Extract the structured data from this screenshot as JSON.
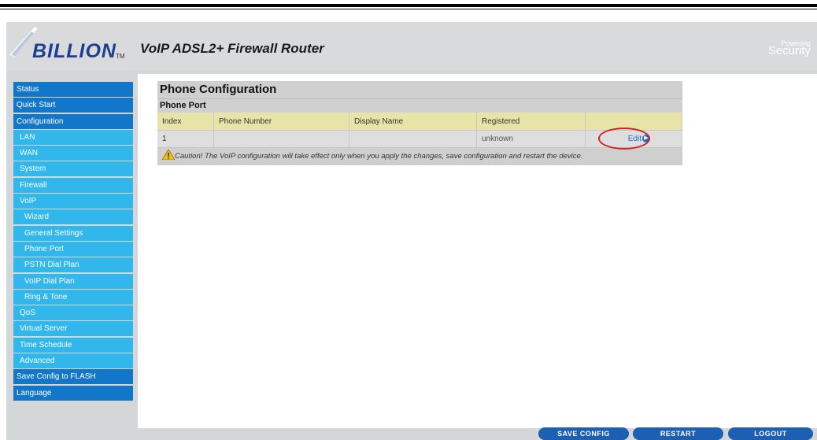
{
  "header": {
    "logo": "BILLION",
    "logo_tm": "TM",
    "product_title": "VoIP ADSL2+ Firewall Router",
    "tagline_line1": "Powering",
    "tagline_line2": "Security"
  },
  "sidebar": {
    "items": [
      {
        "label": "Status",
        "level": 0
      },
      {
        "label": "Quick Start",
        "level": 0
      },
      {
        "label": "Configuration",
        "level": 0
      },
      {
        "label": "LAN",
        "level": 1
      },
      {
        "label": "WAN",
        "level": 1
      },
      {
        "label": "System",
        "level": 1
      },
      {
        "label": "Firewall",
        "level": 1
      },
      {
        "label": "VoIP",
        "level": 1
      },
      {
        "label": "Wizard",
        "level": 2
      },
      {
        "label": "General Settings",
        "level": 2
      },
      {
        "label": "Phone Port",
        "level": 2
      },
      {
        "label": "PSTN Dial Plan",
        "level": 2
      },
      {
        "label": "VoIP Dial Plan",
        "level": 2
      },
      {
        "label": "Ring & Tone",
        "level": 2
      },
      {
        "label": "QoS",
        "level": 1
      },
      {
        "label": "Virtual Server",
        "level": 1
      },
      {
        "label": "Time Schedule",
        "level": 1
      },
      {
        "label": "Advanced",
        "level": 1
      },
      {
        "label": "Save Config to FLASH",
        "level": 0
      },
      {
        "label": "Language",
        "level": 0
      }
    ]
  },
  "main": {
    "title": "Phone Configuration",
    "subtitle": "Phone Port",
    "columns": [
      "Index",
      "Phone Number",
      "Display Name",
      "Registered",
      ""
    ],
    "rows": [
      {
        "index": "1",
        "phone_number": "",
        "display_name": "",
        "registered": "unknown",
        "action": "Edit"
      }
    ],
    "caution": "Caution! The VoIP configuration will take effect only when you apply the changes, save configuration and restart the device."
  },
  "footer": {
    "save_config": "SAVE CONFIG",
    "restart": "RESTART",
    "logout": "LOGOUT"
  },
  "colors": {
    "nav_top": "#1277c8",
    "nav_sub": "#31b7ec",
    "header_bg": "#e8e4a8",
    "button_bg": "#1d5fb2",
    "highlight": "#cc2222"
  }
}
